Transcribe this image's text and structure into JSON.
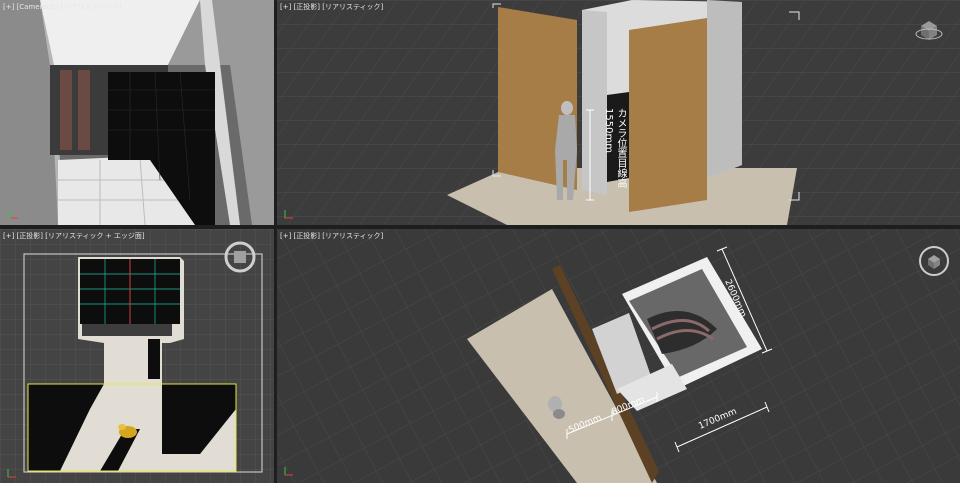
{
  "viewports": {
    "camera": {
      "label": "[+] [Camera01] [リアリスティック]"
    },
    "perspective": {
      "label": "[+] [正投影] [リアリスティック]"
    },
    "top": {
      "label": "[+] [正投影] [リアリスティック + エッジ面]"
    },
    "ortho": {
      "label": "[+] [正投影] [リアリスティック]"
    }
  },
  "dimensions": {
    "camera_height": "カメラ位置目線高",
    "camera_height_value": "1550mm",
    "depth": "2600mm",
    "width": "1700mm",
    "offset_a": "500mm",
    "offset_b": "800mm"
  },
  "colors": {
    "active_border": "#c8a23c",
    "wood": "#a67c47",
    "wall": "#d8d8d8",
    "floor": "#c9bfae",
    "grid": "#4a4a4a"
  }
}
